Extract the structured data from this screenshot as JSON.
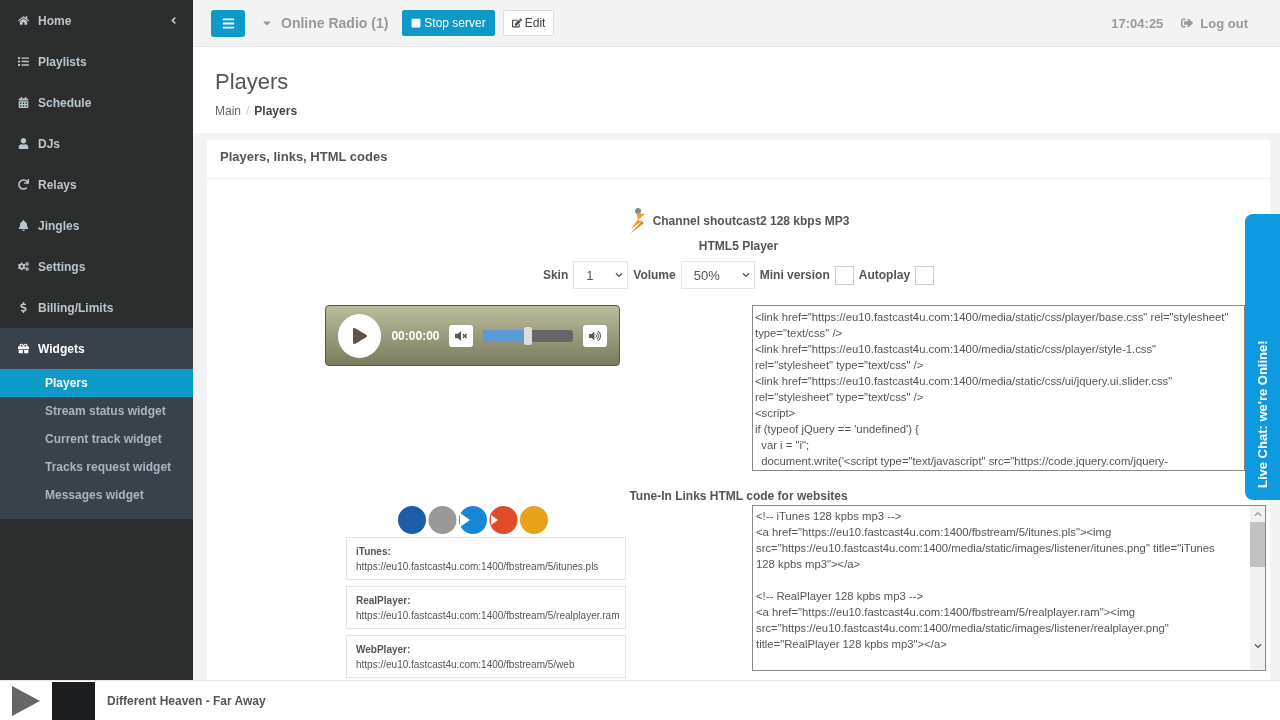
{
  "sidebar": {
    "items": [
      {
        "label": "Home",
        "selected": false
      },
      {
        "label": "Playlists",
        "selected": false
      },
      {
        "label": "Schedule",
        "selected": false
      },
      {
        "label": "DJs",
        "selected": false
      },
      {
        "label": "Relays",
        "selected": false
      },
      {
        "label": "Jingles",
        "selected": false
      },
      {
        "label": "Settings",
        "selected": false
      },
      {
        "label": "Billing/Limits",
        "selected": false
      },
      {
        "label": "Widgets",
        "selected": true,
        "children": [
          {
            "label": "Players",
            "selected": true
          },
          {
            "label": "Stream status widget",
            "selected": false
          },
          {
            "label": "Current track widget",
            "selected": false
          },
          {
            "label": "Tracks request widget",
            "selected": false
          },
          {
            "label": "Messages widget",
            "selected": false
          }
        ]
      }
    ]
  },
  "topbar": {
    "server": "Online Radio (1)",
    "stop_button": "Stop server",
    "edit_button": "Edit",
    "clock": "17:04:25",
    "logout": "Log out"
  },
  "page": {
    "title": "Players",
    "breadcrumb_separator": "/",
    "breadcrumb": [
      {
        "label": "Main",
        "selected": false
      },
      {
        "label": "Players",
        "selected": true
      }
    ]
  },
  "panel": {
    "heading": "Players, links, HTML codes",
    "channel": "Channel shoutcast2 128 kbps MP3",
    "player_type": "HTML5 Player",
    "options": {
      "skin_label": "Skin",
      "skin": "1",
      "volume_label": "Volume",
      "volume": "50%",
      "mini_label": "Mini version",
      "mini_checked": false,
      "autoplay_label": "Autoplay",
      "autoplay_checked": false
    },
    "player": {
      "time": "00:00:00",
      "level": 0.5
    },
    "player_code": [
      "<link href=\"https://eu10.fastcast4u.com:1400/media/static/css/player/base.css\" rel=\"stylesheet\"",
      "type=\"text/css\" />",
      "<link href=\"https://eu10.fastcast4u.com:1400/media/static/css/player/style-1.css\"",
      "rel=\"stylesheet\" type=\"text/css\" />",
      "<link href=\"https://eu10.fastcast4u.com:1400/media/static/css/ui/jquery.ui.slider.css\"",
      "rel=\"stylesheet\" type=\"text/css\" />",
      "<script>",
      "if (typeof jQuery == 'undefined') {",
      "  var i = \"i\";",
      "  document.write('<script type=\"text/javascript\" src=\"https://code.jquery.com/jquery-"
    ],
    "tunein_heading": "Tune-In Links HTML code for websites",
    "links": [
      {
        "name": "iTunes:",
        "url": "https://eu10.fastcast4u.com:1400/fbstream/5/itunes.pls"
      },
      {
        "name": "RealPlayer:",
        "url": "https://eu10.fastcast4u.com:1400/fbstream/5/realplayer.ram"
      },
      {
        "name": "WebPlayer:",
        "url": "https://eu10.fastcast4u.com:1400/fbstream/5/web"
      }
    ],
    "tunein_code": [
      [
        "<!-- iTunes 128 kpbs mp3 -->",
        "<a href=\"https://eu10.fastcast4u.com:1400/fbstream/5/itunes.pls\"><img",
        "src=\"https://eu10.fastcast4u.com:1400/media/static/images/listener/itunes.png\" title=\"iTunes",
        "128 kpbs mp3\"></a>"
      ],
      [
        "<!-- RealPlayer 128 kpbs mp3 -->",
        "<a href=\"https://eu10.fastcast4u.com:1400/fbstream/5/realplayer.ram\"><img",
        "src=\"https://eu10.fastcast4u.com:1400/media/static/images/listener/realplayer.png\"",
        "title=\"RealPlayer 128 kpbs mp3\"></a>"
      ]
    ]
  },
  "live_chat": "Live Chat: we're Online!",
  "now_playing": {
    "track": "Different Heaven - Far Away"
  }
}
